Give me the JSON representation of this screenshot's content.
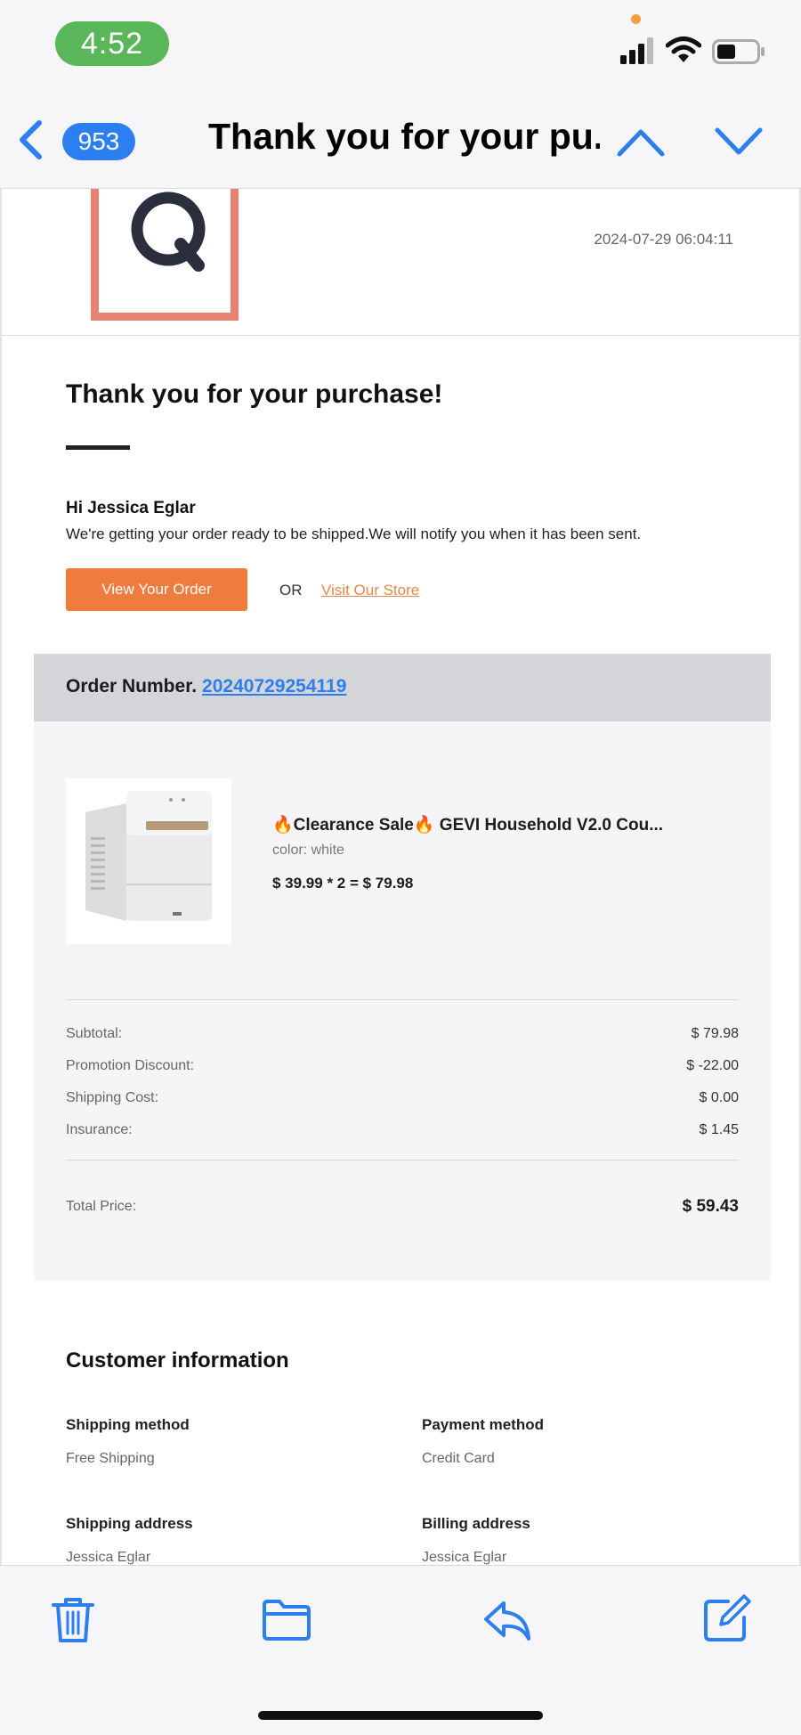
{
  "status_bar": {
    "time": "4:52"
  },
  "nav": {
    "unread_count": "953",
    "title": "Thank you for your pu..."
  },
  "email": {
    "date": "2024-07-29 06:04:11",
    "heading": "Thank you for your purchase!",
    "greeting": "Hi Jessica Eglar",
    "message": "We're getting your order ready to be shipped.We will notify you when it has been sent.",
    "view_order_label": "View Your Order",
    "or_text": "OR",
    "store_link_label": "Visit Our Store",
    "order_label": "Order Number.",
    "order_number": "20240729254119",
    "product": {
      "name": "🔥Clearance Sale🔥 GEVI Household V2.0 Cou...",
      "color": "color: white",
      "price_line": "$ 39.99 * 2 = $ 79.98"
    },
    "summary": [
      {
        "label": "Subtotal:",
        "value": "$ 79.98"
      },
      {
        "label": "Promotion Discount:",
        "value": "$ -22.00"
      },
      {
        "label": "Shipping Cost:",
        "value": "$ 0.00"
      },
      {
        "label": "Insurance:",
        "value": "$ 1.45"
      }
    ],
    "total_label": "Total Price:",
    "total_value": "$ 59.43",
    "customer": {
      "title": "Customer information",
      "shipping_method_label": "Shipping method",
      "shipping_method_value": "Free Shipping",
      "payment_method_label": "Payment method",
      "payment_method_value": "Credit Card",
      "shipping_address_label": "Shipping address",
      "shipping_address_value": "Jessica Eglar",
      "billing_address_label": "Billing address",
      "billing_address_value": "Jessica Eglar"
    }
  },
  "toolbar": {
    "icons": [
      "trash-icon",
      "folder-icon",
      "reply-icon",
      "compose-icon"
    ]
  },
  "colors": {
    "accent_blue": "#2c7ff0",
    "order_button": "#ef7b3f",
    "logo_border": "#e58272",
    "time_pill": "#59b75a"
  }
}
